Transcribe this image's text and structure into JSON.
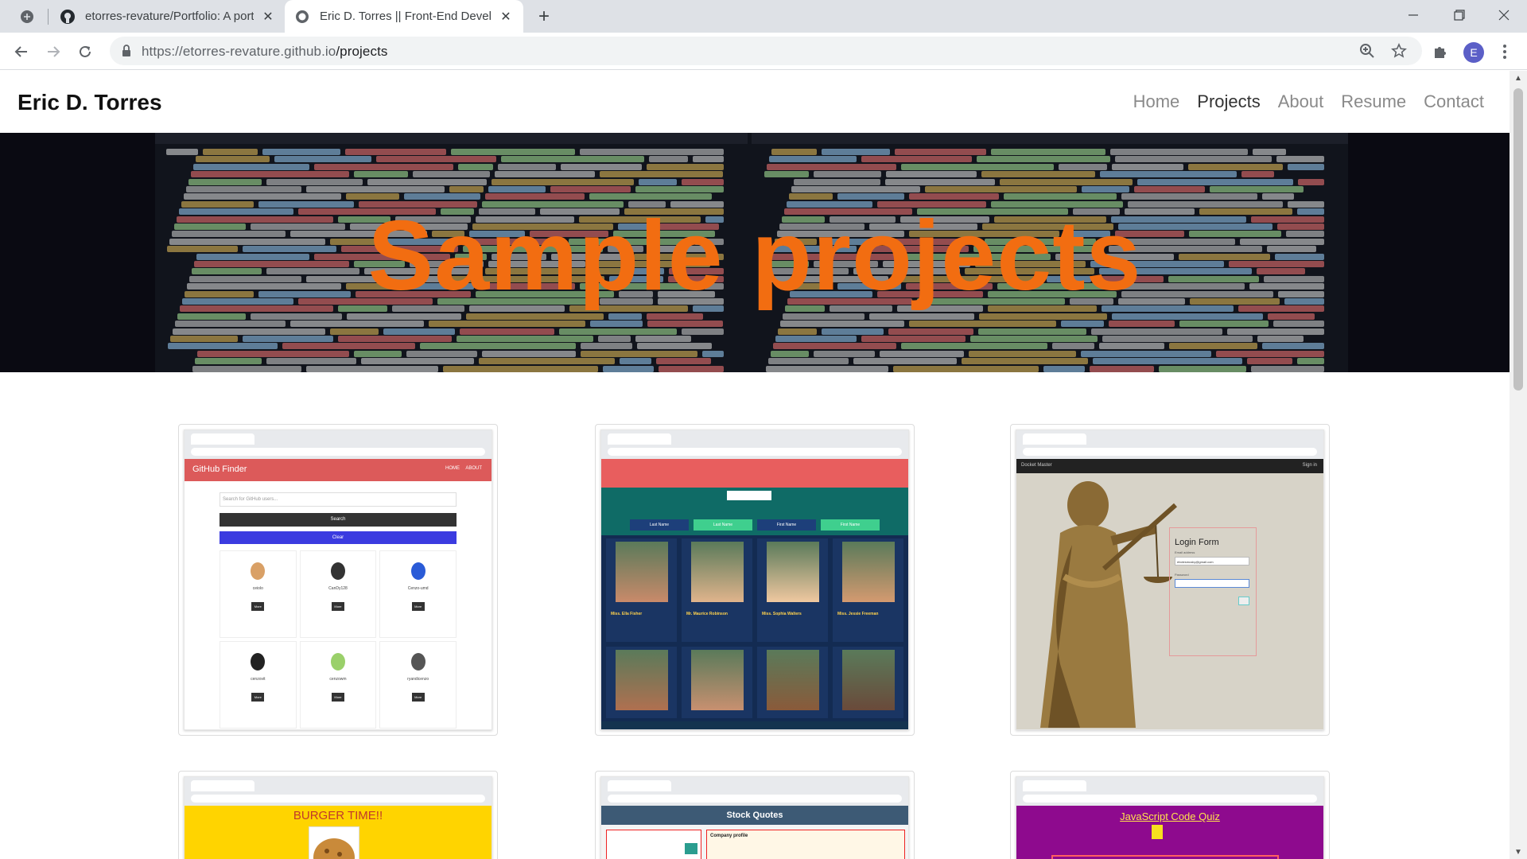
{
  "browser": {
    "tabs": [
      {
        "title": "etorres-revature/Portfolio: A port",
        "active": false
      },
      {
        "title": "Eric D. Torres || Front-End Develo",
        "active": true
      }
    ],
    "url_host": "https://etorres-revature.github.io",
    "url_path": "/projects",
    "profile_initial": "E"
  },
  "site": {
    "brand": "Eric D. Torres",
    "nav": [
      {
        "label": "Home",
        "active": false
      },
      {
        "label": "Projects",
        "active": true
      },
      {
        "label": "About",
        "active": false
      },
      {
        "label": "Resume",
        "active": false
      },
      {
        "label": "Contact",
        "active": false
      }
    ],
    "hero_title": "Sample projects",
    "hero_title_color": "#f26d11",
    "projects": [
      {
        "header": "GitHub Finder",
        "header_nav": [
          "HOME",
          "ABOUT"
        ],
        "search_placeholder": "Search for GitHub users...",
        "search_button": "Search",
        "clear_button": "Clear",
        "users": [
          "ceiolo",
          "CanDy128",
          "Cenzo-umd",
          "cenzovit",
          "cenzowm",
          "ryandicenzo"
        ],
        "more_label": "More"
      },
      {
        "columns": [
          "Last Name",
          "Last Name",
          "First Name",
          "First Name"
        ],
        "people": [
          "Miss. Ella Fisher",
          "Mr. Maurice Robinson",
          "Miss. Sophia Walters",
          "Miss. Jessie Freeman"
        ]
      },
      {
        "topbar_title": "Docket Master",
        "topbar_link": "Sign in",
        "form_title": "Login Form",
        "email_label": "Email address",
        "email_value": "ebctesmusky@gmail.com",
        "password_label": "Password"
      },
      {
        "title": "BURGER TIME!!"
      },
      {
        "title": "Stock Quotes",
        "section": "Company profile"
      },
      {
        "title": "JavaScript Code Quiz"
      }
    ]
  }
}
